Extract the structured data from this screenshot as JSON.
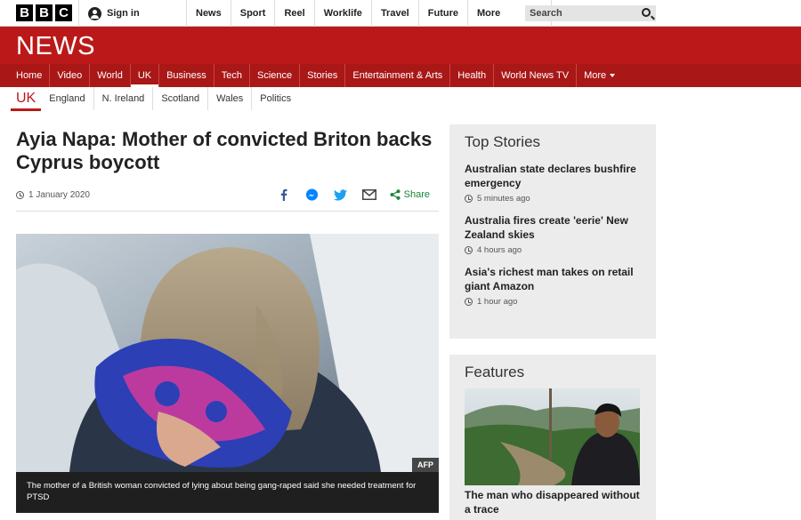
{
  "topbar": {
    "logo": [
      "B",
      "B",
      "C"
    ],
    "signin_label": "Sign in",
    "nav": [
      "News",
      "Sport",
      "Reel",
      "Worklife",
      "Travel",
      "Future"
    ],
    "more_label": "More",
    "search_placeholder": "Search"
  },
  "banner": {
    "title": "NEWS",
    "color": "#bb1919"
  },
  "mainnav": {
    "items": [
      "Home",
      "Video",
      "World",
      "UK",
      "Business",
      "Tech",
      "Science",
      "Stories",
      "Entertainment & Arts",
      "Health",
      "World News TV"
    ],
    "more_label": "More",
    "active": "UK"
  },
  "subnav": {
    "current": "UK",
    "items": [
      "England",
      "N. Ireland",
      "Scotland",
      "Wales",
      "Politics"
    ]
  },
  "article": {
    "headline": "Ayia Napa: Mother of convicted Briton backs Cyprus boycott",
    "date": "1 January 2020",
    "share_label": "Share",
    "image_credit": "AFP",
    "caption": "The mother of a British woman convicted of lying about being gang-raped said she needed treatment for PTSD"
  },
  "top_stories": {
    "title": "Top Stories",
    "items": [
      {
        "title": "Australian state declares bushfire emergency",
        "time": "5 minutes ago"
      },
      {
        "title": "Australia fires create 'eerie' New Zealand skies",
        "time": "4 hours ago"
      },
      {
        "title": "Asia's richest man takes on retail giant Amazon",
        "time": "1 hour ago"
      }
    ]
  },
  "features": {
    "title": "Features",
    "items": [
      {
        "title": "The man who disappeared without a trace"
      }
    ]
  }
}
